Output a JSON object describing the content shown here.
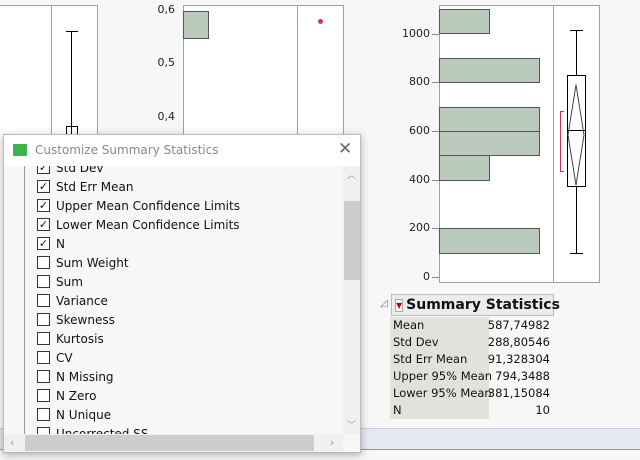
{
  "middle_axis": {
    "ticks": [
      "0,6",
      "0,5",
      "0,4"
    ]
  },
  "right_axis": {
    "ticks": [
      "1000",
      "800",
      "600",
      "400",
      "200",
      "0"
    ]
  },
  "histogram_bins": [
    {
      "from": 1000,
      "to": 1100,
      "count": 1
    },
    {
      "from": 800,
      "to": 900,
      "count": 2
    },
    {
      "from": 600,
      "to": 700,
      "count": 2
    },
    {
      "from": 500,
      "to": 600,
      "count": 2
    },
    {
      "from": 400,
      "to": 500,
      "count": 1
    },
    {
      "from": 100,
      "to": 200,
      "count": 2
    }
  ],
  "boxplot": {
    "min": 104,
    "q1": 375,
    "median": 608,
    "q3": 835,
    "max": 1020,
    "mean": 587.75,
    "lower_ci": 381.15,
    "upper_ci": 794.35
  },
  "summary": {
    "title": "Summary Statistics",
    "rows": [
      {
        "label": "Mean",
        "value": "587,74982"
      },
      {
        "label": "Std Dev",
        "value": "288,80546"
      },
      {
        "label": "Std Err Mean",
        "value": "91,328304"
      },
      {
        "label": "Upper 95% Mean",
        "value": "794,3488"
      },
      {
        "label": "Lower 95% Mean",
        "value": "381,15084"
      },
      {
        "label": "N",
        "value": "10"
      }
    ]
  },
  "dialog": {
    "title": "Customize Summary Statistics",
    "items": [
      {
        "label": "Std Dev",
        "checked": true
      },
      {
        "label": "Std Err Mean",
        "checked": true
      },
      {
        "label": "Upper Mean Confidence Limits",
        "checked": true
      },
      {
        "label": "Lower Mean Confidence Limits",
        "checked": true
      },
      {
        "label": "N",
        "checked": true
      },
      {
        "label": "Sum Weight",
        "checked": false
      },
      {
        "label": "Sum",
        "checked": false
      },
      {
        "label": "Variance",
        "checked": false
      },
      {
        "label": "Skewness",
        "checked": false
      },
      {
        "label": "Kurtosis",
        "checked": false
      },
      {
        "label": "CV",
        "checked": false
      },
      {
        "label": "N Missing",
        "checked": false
      },
      {
        "label": "N Zero",
        "checked": false
      },
      {
        "label": "N Unique",
        "checked": false
      },
      {
        "label": "Uncorrected SS",
        "checked": false
      }
    ]
  },
  "colors": {
    "bar": "#b9c9bb",
    "accent": "#d0384f"
  }
}
